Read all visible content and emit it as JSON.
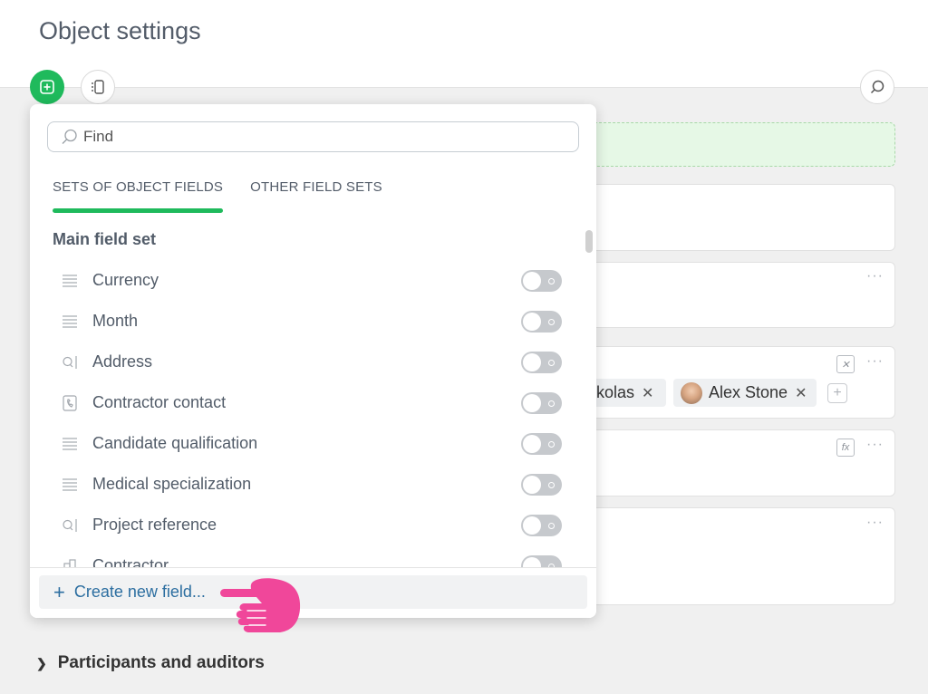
{
  "page": {
    "title": "Object settings"
  },
  "toolbar": {
    "add_icon": "plus-square-icon",
    "layout_icon": "layout-icon",
    "search_icon": "search-icon"
  },
  "panel": {
    "search_placeholder": "Find",
    "tabs": [
      {
        "label": "SETS OF OBJECT FIELDS",
        "active": true
      },
      {
        "label": "OTHER FIELD SETS",
        "active": false
      }
    ],
    "section_title": "Main field set",
    "fields": [
      {
        "label": "Currency",
        "icon": "list-icon",
        "enabled": false
      },
      {
        "label": "Month",
        "icon": "list-icon",
        "enabled": false
      },
      {
        "label": "Address",
        "icon": "address-icon",
        "enabled": false
      },
      {
        "label": "Contractor contact",
        "icon": "contact-icon",
        "enabled": false
      },
      {
        "label": "Candidate qualification",
        "icon": "list-icon",
        "enabled": false
      },
      {
        "label": "Medical specialization",
        "icon": "list-icon",
        "enabled": false
      },
      {
        "label": "Project reference",
        "icon": "address-icon",
        "enabled": false
      },
      {
        "label": "Contractor",
        "icon": "company-icon",
        "enabled": false
      }
    ],
    "create_label": "Create new field..."
  },
  "background": {
    "chips": [
      {
        "label": "kolas"
      },
      {
        "label": "Alex Stone"
      }
    ],
    "participants_label": "Participants and auditors"
  },
  "colors": {
    "accent": "#1fba5c",
    "link": "#2c6ea0",
    "pointer": "#f0479a"
  }
}
